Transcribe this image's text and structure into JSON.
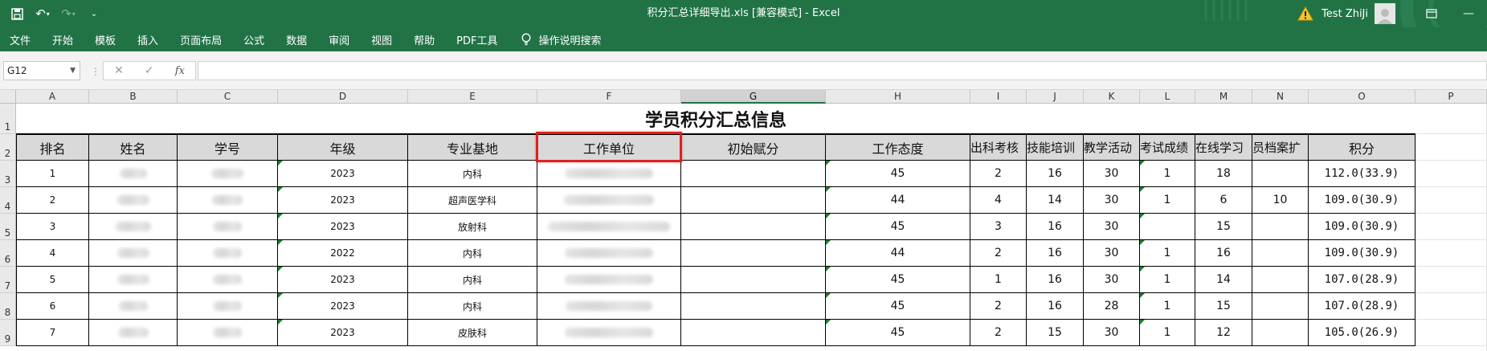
{
  "titlebar": {
    "title": "积分汇总详细导出.xls  [兼容模式]  -  Excel",
    "user": "Test ZhiJi"
  },
  "ribbon": {
    "tabs": [
      "文件",
      "开始",
      "模板",
      "插入",
      "页面布局",
      "公式",
      "数据",
      "审阅",
      "视图",
      "帮助",
      "PDF工具"
    ],
    "search": "操作说明搜索"
  },
  "formula_bar": {
    "name_box": "G12",
    "formula": ""
  },
  "sheet": {
    "columns": [
      "A",
      "B",
      "C",
      "D",
      "E",
      "F",
      "G",
      "H",
      "I",
      "J",
      "K",
      "L",
      "M",
      "N",
      "O",
      "P"
    ],
    "rows": [
      "1",
      "2",
      "3",
      "4",
      "5",
      "6",
      "7",
      "8",
      "9"
    ],
    "title": "学员积分汇总信息",
    "headers": [
      "排名",
      "姓名",
      "学号",
      "年级",
      "专业基地",
      "工作单位",
      "初始赋分",
      "工作态度",
      "出科考核",
      "技能培训",
      "教学活动",
      "考试成绩",
      "在线学习",
      "员档案扩",
      "积分"
    ],
    "data": [
      {
        "rank": "1",
        "grade": "2023",
        "base": "内科",
        "attitude": "45",
        "exam": "2",
        "skill": "16",
        "teach": "30",
        "test": "1",
        "online": "18",
        "archive": "",
        "score": "112.0(33.9)"
      },
      {
        "rank": "2",
        "grade": "2023",
        "base": "超声医学科",
        "attitude": "44",
        "exam": "4",
        "skill": "14",
        "teach": "30",
        "test": "1",
        "online": "6",
        "archive": "10",
        "score": "109.0(30.9)"
      },
      {
        "rank": "3",
        "grade": "2023",
        "base": "放射科",
        "attitude": "45",
        "exam": "3",
        "skill": "16",
        "teach": "30",
        "test": "",
        "online": "15",
        "archive": "",
        "score": "109.0(30.9)"
      },
      {
        "rank": "4",
        "grade": "2022",
        "base": "内科",
        "attitude": "44",
        "exam": "2",
        "skill": "16",
        "teach": "30",
        "test": "1",
        "online": "16",
        "archive": "",
        "score": "109.0(30.9)"
      },
      {
        "rank": "5",
        "grade": "2023",
        "base": "内科",
        "attitude": "45",
        "exam": "1",
        "skill": "16",
        "teach": "30",
        "test": "1",
        "online": "14",
        "archive": "",
        "score": "107.0(28.9)"
      },
      {
        "rank": "6",
        "grade": "2023",
        "base": "内科",
        "attitude": "45",
        "exam": "2",
        "skill": "16",
        "teach": "28",
        "test": "1",
        "online": "15",
        "archive": "",
        "score": "107.0(28.9)"
      },
      {
        "rank": "7",
        "grade": "2023",
        "base": "皮肤科",
        "attitude": "45",
        "exam": "2",
        "skill": "15",
        "teach": "30",
        "test": "1",
        "online": "12",
        "archive": "",
        "score": "105.0(26.9)"
      }
    ]
  },
  "colors": {
    "excel_green": "#217346",
    "highlight_red": "#e02020",
    "header_fill": "#d9d9d9"
  },
  "icons": [
    "save-icon",
    "undo-icon",
    "redo-icon",
    "customize-icon",
    "warning-icon",
    "avatar-icon",
    "ribbon-display-icon",
    "minimize-icon",
    "lightbulb-icon",
    "cancel-icon",
    "enter-icon",
    "function-icon"
  ]
}
